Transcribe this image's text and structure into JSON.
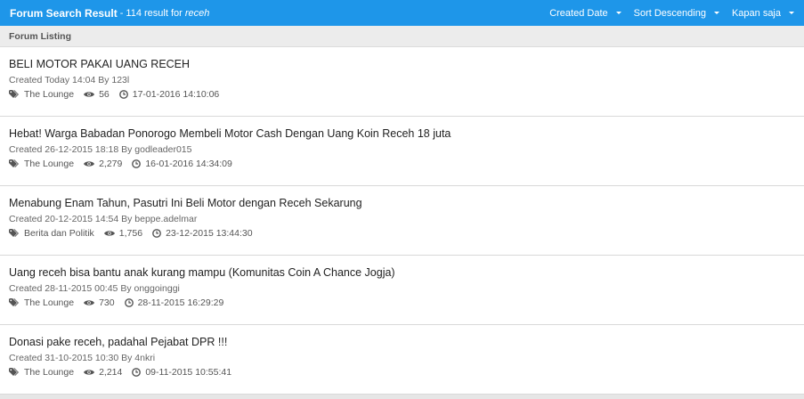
{
  "header": {
    "title": "Forum Search Result",
    "result_prefix": " - 114 result for ",
    "query": "receh",
    "controls": [
      {
        "label": "Created Date"
      },
      {
        "label": "Sort Descending"
      },
      {
        "label": "Kapan saja"
      }
    ]
  },
  "section": {
    "label": "Forum Listing"
  },
  "threads": [
    {
      "title": "BELI MOTOR PAKAI UANG RECEH",
      "created": "Created Today 14:04 By 123l",
      "category": "The Lounge",
      "views": "56",
      "last": "17-01-2016 14:10:06"
    },
    {
      "title": "Hebat! Warga Babadan Ponorogo Membeli Motor Cash Dengan Uang Koin Receh 18 juta",
      "created": "Created 26-12-2015 18:18 By godleader015",
      "category": "The Lounge",
      "views": "2,279",
      "last": "16-01-2016 14:34:09"
    },
    {
      "title": "Menabung Enam Tahun, Pasutri Ini Beli Motor dengan Receh Sekarung",
      "created": "Created 20-12-2015 14:54 By beppe.adelmar",
      "category": "Berita dan Politik",
      "views": "1,756",
      "last": "23-12-2015 13:44:30"
    },
    {
      "title": "Uang receh bisa bantu anak kurang mampu (Komunitas Coin A Chance Jogja)",
      "created": "Created 28-11-2015 00:45 By onggoinggi",
      "category": "The Lounge",
      "views": "730",
      "last": "28-11-2015 16:29:29"
    },
    {
      "title": "Donasi pake receh, padahal Pejabat DPR !!!",
      "created": "Created 31-10-2015 10:30 By 4nkri",
      "category": "The Lounge",
      "views": "2,214",
      "last": "09-11-2015 10:55:41"
    }
  ]
}
